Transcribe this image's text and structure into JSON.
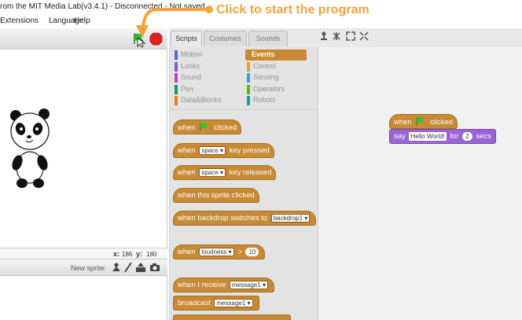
{
  "window": {
    "title": "rom the MIT Media Lab(v3.4.1) - Disconnected - Not saved"
  },
  "menu": {
    "items": [
      "Extensions",
      "Language",
      "Help"
    ]
  },
  "annotation": {
    "text": "Click to start the program"
  },
  "stage": {
    "x_label": "x:",
    "x_value": "186",
    "y_label": "y:",
    "y_value": "180",
    "new_sprite_label": "New sprite:"
  },
  "tabs": [
    "Scripts",
    "Costumes",
    "Sounds"
  ],
  "categories": {
    "left": [
      {
        "label": "Motion",
        "color": "#4a6cd4"
      },
      {
        "label": "Looks",
        "color": "#8a55d7"
      },
      {
        "label": "Sound",
        "color": "#bb42c3"
      },
      {
        "label": "Pen",
        "color": "#0e9a6c"
      },
      {
        "label": "Data&Blocks",
        "color": "#ee7d16"
      }
    ],
    "right": [
      {
        "label": "Events",
        "color": "#c88a34"
      },
      {
        "label": "Control",
        "color": "#e1a91a"
      },
      {
        "label": "Sensing",
        "color": "#2ca5e2"
      },
      {
        "label": "Operators",
        "color": "#5cb712"
      },
      {
        "label": "Robots",
        "color": "#11a39b"
      }
    ],
    "selected": "Events"
  },
  "palette": {
    "when_flag": {
      "pre": "when",
      "post": "clicked"
    },
    "when_key_pressed": {
      "pre": "when",
      "key": "space",
      "post": "key pressed"
    },
    "when_key_released": {
      "pre": "when",
      "key": "space",
      "post": "key released"
    },
    "when_sprite_clicked": {
      "text": "when this sprite clicked"
    },
    "when_backdrop": {
      "pre": "when backdrop switches to",
      "value": "backdrop1"
    },
    "when_loudness": {
      "pre": "when",
      "sensor": "loudness",
      "op": ">",
      "value": "10"
    },
    "when_receive": {
      "pre": "when I receive",
      "message": "message1"
    },
    "broadcast": {
      "pre": "broadcast",
      "message": "message1"
    }
  },
  "script": {
    "hat": {
      "pre": "when",
      "post": "clicked"
    },
    "say": {
      "pre": "say",
      "text": "Hello World!",
      "mid": "for",
      "secs": "2",
      "post": "secs"
    }
  },
  "colors": {
    "events": "#c88a34",
    "looks": "#9a63d6",
    "callout": "#f2a33b",
    "flag": "#2ec52e",
    "stop": "#e02020"
  }
}
